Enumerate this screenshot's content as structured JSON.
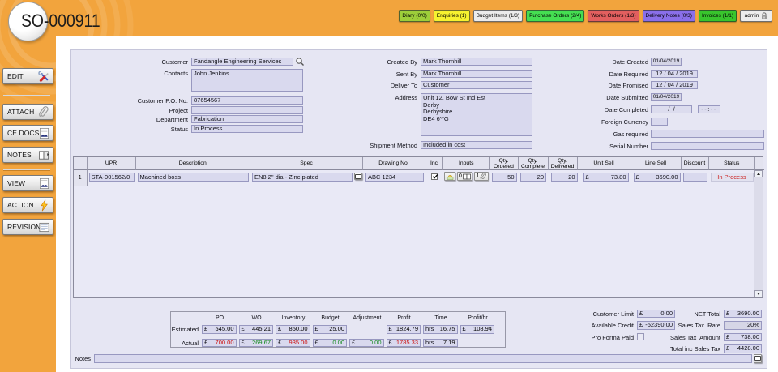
{
  "header": {
    "title": "SO-000911",
    "nav_buttons": [
      {
        "label": "Diary (0/0)",
        "color": "#9dce3a"
      },
      {
        "label": "Enquiries (1)",
        "color": "#f6f22f"
      },
      {
        "label": "Budget Items (1/3)",
        "color": "#ececec"
      },
      {
        "label": "Purchase Orders (2/4)",
        "color": "#45de52"
      },
      {
        "label": "Works Orders (1/3)",
        "color": "#e25f5f"
      },
      {
        "label": "Delivery Notes (0/3)",
        "color": "#8a6fe9"
      },
      {
        "label": "Invoices (1/1)",
        "color": "#38c52d"
      },
      {
        "label": "admin",
        "color": "#ededed"
      }
    ]
  },
  "sidebar": {
    "buttons": [
      {
        "label": "EDIT",
        "icon": "tools-icon"
      },
      {
        "label": "ATTACH",
        "icon": "paperclip-icon"
      },
      {
        "label": "CE DOCS",
        "icon": "document-print-icon"
      },
      {
        "label": "NOTES",
        "icon": "book-icon"
      },
      {
        "label": "VIEW",
        "icon": "document-icon"
      },
      {
        "label": "ACTION",
        "icon": "lightning-icon"
      },
      {
        "label": "REVISIONS",
        "icon": "revisions-icon"
      }
    ]
  },
  "form": {
    "customer": {
      "label": "Customer",
      "value": "Fandangle Engineering Services"
    },
    "contacts": {
      "label": "Contacts",
      "value": "John Jenkins"
    },
    "customer_po_no": {
      "label": "Customer P.O. No.",
      "value": "87654567"
    },
    "project": {
      "label": "Project",
      "value": ""
    },
    "department": {
      "label": "Department",
      "value": "Fabrication"
    },
    "status": {
      "label": "Status",
      "value": "In Process"
    },
    "created_by": {
      "label": "Created By",
      "value": "Mark Thornhill"
    },
    "sent_by": {
      "label": "Sent By",
      "value": "Mark Thornhill"
    },
    "deliver_to": {
      "label": "Deliver To",
      "value": "Customer"
    },
    "address": {
      "label": "Address",
      "value": "Unit 12, Bow St Ind Est\nDerby\nDerbyshire\nDE4 6YG"
    },
    "shipment_method": {
      "label": "Shipment Method",
      "value": "Included in cost"
    },
    "date_created": {
      "label": "Date Created",
      "value": "01/04/2019"
    },
    "date_required": {
      "label": "Date Required",
      "value": "12 / 04 / 2019"
    },
    "date_promised": {
      "label": "Date Promised",
      "value": "12 / 04 / 2019"
    },
    "date_submitted": {
      "label": "Date Submitted",
      "value": "01/04/2019"
    },
    "date_completed": {
      "label": "Date Completed",
      "value_date": "/  /",
      "value_time": "--:--"
    },
    "foreign_currency": {
      "label": "Foreign Currency",
      "value": ""
    },
    "gas_required": {
      "label": "Gas required",
      "value": ""
    },
    "serial_number": {
      "label": "Serial Number",
      "value": ""
    }
  },
  "grid": {
    "columns": [
      "UPR",
      "Description",
      "Spec",
      "Drawing No.",
      "Inc",
      "Inputs",
      "Qty. Ordered",
      "Qty. Complete",
      "Qty. Delivered",
      "Unit Sell",
      "Line Sell",
      "Discount",
      "Status"
    ],
    "rows": [
      {
        "num": "1",
        "upr": "STA-001562/0",
        "description": "Machined boss",
        "spec": "EN8 2\" dia - Zinc plated",
        "drawing_no": "ABC 1234",
        "inc_checked": true,
        "inputs_docs_count": "0",
        "inputs_attach_count": "1",
        "qty_ordered": "50",
        "qty_complete": "20",
        "qty_delivered": "20",
        "unit_sell": {
          "currency": "£",
          "value": "73.80"
        },
        "line_sell": {
          "currency": "£",
          "value": "3690.00"
        },
        "discount": "",
        "status": "In Process",
        "status_color": "#cc2222"
      }
    ]
  },
  "summary": {
    "columns": [
      "PO",
      "WO",
      "Inventory",
      "Budget",
      "Adjustment",
      "Profit",
      "Time",
      "Profit/hr"
    ],
    "estimated_label": "Estimated",
    "actual_label": "Actual",
    "estimated": {
      "po": {
        "prefix": "£",
        "value": "545.00",
        "color": "#000000"
      },
      "wo": {
        "prefix": "£",
        "value": "445.21",
        "color": "#000000"
      },
      "inventory": {
        "prefix": "£",
        "value": "850.00",
        "color": "#000000"
      },
      "budget": {
        "prefix": "£",
        "value": "25.00",
        "color": "#000000"
      },
      "profit": {
        "prefix": "£",
        "value": "1824.79",
        "color": "#000000"
      },
      "time": {
        "prefix": "hrs",
        "value": "16.75",
        "color": "#000000"
      },
      "profit_hr": {
        "prefix": "£",
        "value": "108.94",
        "color": "#000000"
      }
    },
    "actual": {
      "po": {
        "prefix": "£",
        "value": "700.00",
        "color": "#cc1111"
      },
      "wo": {
        "prefix": "£",
        "value": "269.67",
        "color": "#11881c"
      },
      "inventory": {
        "prefix": "£",
        "value": "935.00",
        "color": "#cc1111"
      },
      "budget": {
        "prefix": "£",
        "value": "0.00",
        "color": "#11881c"
      },
      "adjustment": {
        "prefix": "£",
        "value": "0.00",
        "color": "#11881c"
      },
      "profit": {
        "prefix": "£",
        "value": "1785.33",
        "color": "#cc1111"
      },
      "time": {
        "prefix": "hrs",
        "value": "7.19",
        "color": "#000000"
      }
    }
  },
  "totals": {
    "customer_limit": {
      "label": "Customer Limit",
      "prefix": "£",
      "value": "0.00"
    },
    "available_credit": {
      "label": "Available Credit",
      "prefix": "£",
      "value": "-52390.00"
    },
    "pro_forma_paid": {
      "label": "Pro Forma Paid"
    },
    "net_total": {
      "label": "NET Total",
      "prefix": "£",
      "value": "3690.00"
    },
    "sales_tax_rate": {
      "label": "Sales Tax  Rate",
      "value": "20%"
    },
    "sales_tax_amount": {
      "label": "Sales Tax  Amount",
      "prefix": "£",
      "value": "738.00"
    },
    "total_inc_sales_tax": {
      "label": "Total inc Sales Tax",
      "prefix": "£",
      "value": "4428.00"
    }
  },
  "notes": {
    "label": "Notes",
    "value": ""
  }
}
